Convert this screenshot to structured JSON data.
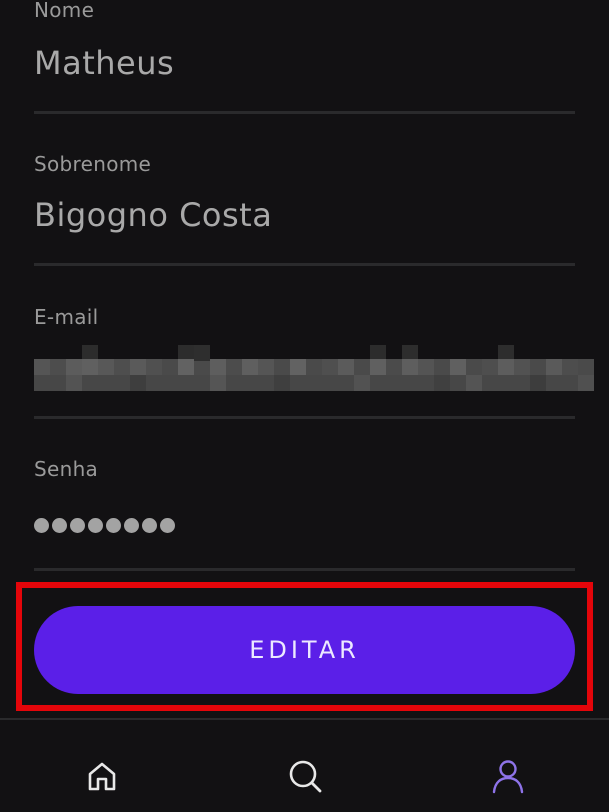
{
  "form": {
    "first_name": {
      "label": "Nome",
      "value": "Matheus"
    },
    "last_name": {
      "label": "Sobrenome",
      "value": "Bigogno Costa"
    },
    "email": {
      "label": "E-mail",
      "value_state": "blurred"
    },
    "password": {
      "label": "Senha",
      "dot_count": 8
    }
  },
  "actions": {
    "edit_label": "EDITAR"
  },
  "bottom_nav": {
    "items": [
      {
        "icon": "home-icon",
        "active": false
      },
      {
        "icon": "search-icon",
        "active": false
      },
      {
        "icon": "user-icon",
        "active": true
      }
    ]
  },
  "colors": {
    "background": "#121113",
    "accent": "#5b1fe8",
    "active_icon": "#8e73e9",
    "highlight": "#e4050a"
  }
}
